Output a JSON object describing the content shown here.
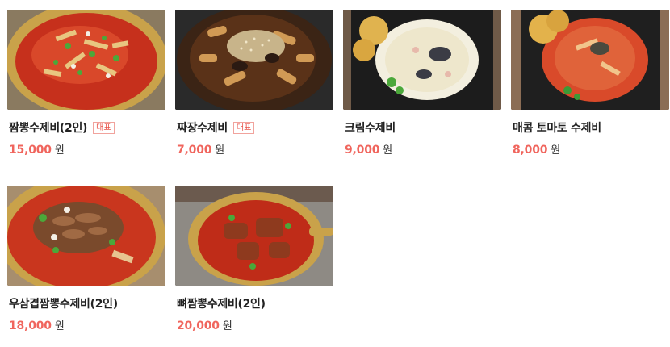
{
  "menu": {
    "items": [
      {
        "name": "짬뽕수제비(2인)",
        "badge": "대표",
        "price": "15,000",
        "currency": "원",
        "image": "spicy-jjamppong-sujebi-pot"
      },
      {
        "name": "짜장수제비",
        "badge": "대표",
        "price": "7,000",
        "currency": "원",
        "image": "jjajang-sujebi-plate"
      },
      {
        "name": "크림수제비",
        "badge": "",
        "price": "9,000",
        "currency": "원",
        "image": "cream-sujebi-plate"
      },
      {
        "name": "매콤 토마토 수제비",
        "badge": "",
        "price": "8,000",
        "currency": "원",
        "image": "spicy-tomato-sujebi-plate"
      },
      {
        "name": "우삼겹짬뽕수제비(2인)",
        "badge": "",
        "price": "18,000",
        "currency": "원",
        "image": "beef-brisket-jjamppong-sujebi-pot"
      },
      {
        "name": "뼈짬뽕수제비(2인)",
        "badge": "",
        "price": "20,000",
        "currency": "원",
        "image": "pork-bone-jjamppong-sujebi-pot"
      }
    ]
  },
  "colors": {
    "price": "#f0655d",
    "badge": "#e8534a",
    "name": "#222222"
  }
}
